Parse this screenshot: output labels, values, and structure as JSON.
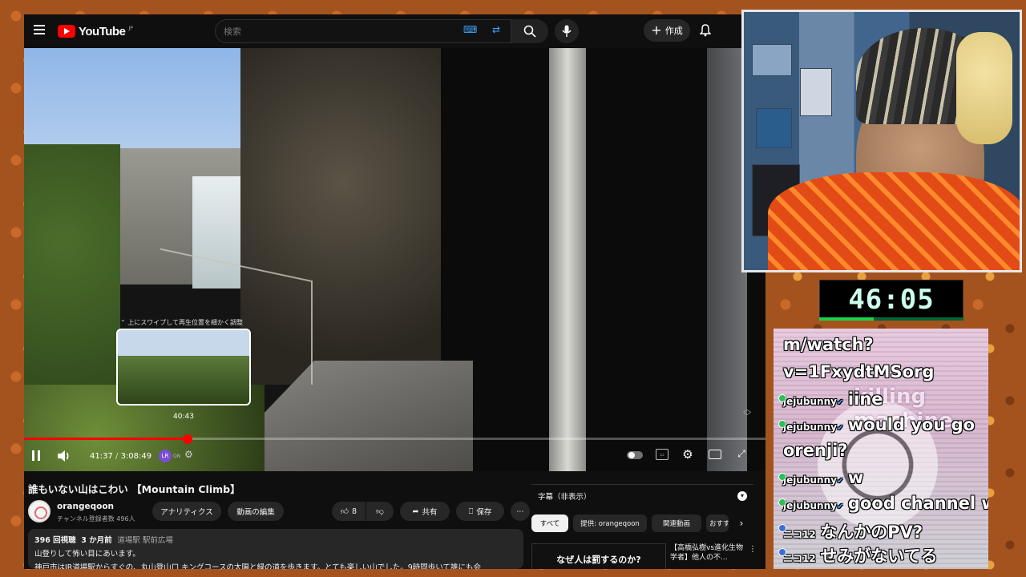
{
  "header": {
    "logo_text": "YouTube",
    "logo_region": "JP",
    "search_placeholder": "検索",
    "create_label": "作成"
  },
  "player": {
    "hint": "上にスワイプして再生位置を細かく調整",
    "preview_time": "40:43",
    "current_time": "41:37",
    "duration": "3:08:49",
    "progress_fraction": 0.221,
    "ext_badge": "LR",
    "ext_state": "ON"
  },
  "video": {
    "title": "誰もいない山はこわい 【Mountain Climb】",
    "channel_name": "orangeqoon",
    "subscribers": "チャンネル登録者数 496人",
    "analytics_label": "アナリティクス",
    "edit_label": "動画の編集",
    "likes": "8",
    "share_label": "共有",
    "save_label": "保存"
  },
  "description": {
    "views": "396 回視聴",
    "date": "3 か月前",
    "location": "道場駅 駅前広場",
    "line1": "山登りして怖い目にあいます。",
    "line2": "神戸市はJR道場駅からすぐの、丸山登山口 キングコースの太陽と緑の道を歩きます。とても楽しい山でした。9時間歩いて誰にも会"
  },
  "sidebar": {
    "subtitles_label": "字幕（非表示）",
    "chips": [
      "すべて",
      "提供: orangeqoon",
      "関連動画",
      "おすすめ"
    ],
    "rec_thumb_text": "なぜ人は罰するのか?",
    "rec_title": "【高橋弘樹vs進化生物学者】他人の不..."
  },
  "overlay": {
    "timer": "46:05",
    "timer_progress_fraction": 0.38
  },
  "chat": {
    "messages": [
      {
        "user": "",
        "text": "m/watch?"
      },
      {
        "user": "",
        "text": "v=1FxydtMSorg"
      },
      {
        "user": "jejubunny",
        "text": "iine"
      },
      {
        "user": "jejubunny",
        "text": "would you go"
      },
      {
        "user": "",
        "text": "orenji?"
      },
      {
        "user": "jejubunny",
        "text": "w"
      },
      {
        "user": "jejubunny",
        "text": "good channel w"
      },
      {
        "user": "ニコ12",
        "text": "なんかのPV?"
      },
      {
        "user": "ニコ12",
        "text": "せみがないてる"
      }
    ],
    "art_text": "killing machine"
  },
  "colors": {
    "yt_red": "#ff0000",
    "timer_green": "#19d34a",
    "chat_badge_blue": "#4aa3ff"
  }
}
